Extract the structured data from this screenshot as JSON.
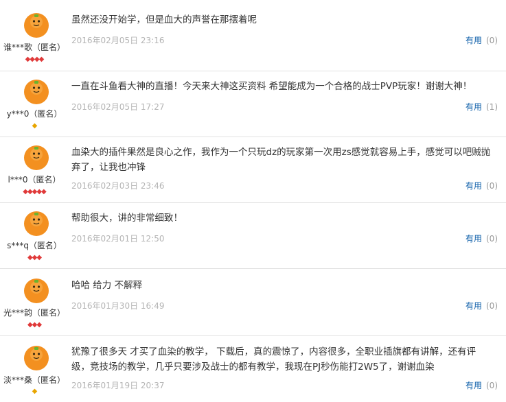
{
  "colors": {
    "avatar_orange": "#f39020",
    "rank_red": "#e03a3a",
    "rank_gold": "#e8a500",
    "link_blue": "#0a5ca8",
    "time_gray": "#b4b4b4",
    "divider": "#e2e2e2"
  },
  "icons": {
    "avatar": "orange-mascot-icon",
    "rank_red": "red-diamond-icon",
    "rank_gold": "gold-diamond-icon"
  },
  "reviews": [
    {
      "user": "谁***歌（匿名）",
      "rank_icons": "◆◆◆◆",
      "rank_color": "red",
      "content": "虽然还没开始学，但是血大的声誉在那摆着呢",
      "time": "2016年02月05日 23:16",
      "useful_label": "有用",
      "useful_count": "(0)"
    },
    {
      "user": "y***0（匿名）",
      "rank_icons": "◆",
      "rank_color": "gold",
      "content": "一直在斗鱼看大神的直播！今天来大神这买资料 希望能成为一个合格的战士PVP玩家！谢谢大神！",
      "time": "2016年02月05日 17:27",
      "useful_label": "有用",
      "useful_count": "(1)"
    },
    {
      "user": "l***0（匿名）",
      "rank_icons": "◆◆◆◆◆",
      "rank_color": "red",
      "content": "血染大的插件果然是良心之作，我作为一个只玩dz的玩家第一次用zs感觉就容易上手，感觉可以吧贼抛弃了，让我也冲锋",
      "time": "2016年02月03日 23:46",
      "useful_label": "有用",
      "useful_count": "(0)"
    },
    {
      "user": "s***q（匿名）",
      "rank_icons": "◆◆◆",
      "rank_color": "red",
      "content": "帮助很大，讲的非常细致！",
      "time": "2016年02月01日 12:50",
      "useful_label": "有用",
      "useful_count": "(0)"
    },
    {
      "user": "光***韵（匿名）",
      "rank_icons": "◆◆◆",
      "rank_color": "red",
      "content": "哈哈 给力 不解释",
      "time": "2016年01月30日 16:49",
      "useful_label": "有用",
      "useful_count": "(0)"
    },
    {
      "user": "淡***桑（匿名）",
      "rank_icons": "◆",
      "rank_color": "gold",
      "content": "犹豫了很多天 才买了血染的教学， 下载后，真的震惊了，内容很多，全职业插旗都有讲解，还有评级，竞技场的教学，几乎只要涉及战士的都有教学，我现在PJ秒伤能打2W5了，谢谢血染",
      "time": "2016年01月19日 20:37",
      "useful_label": "有用",
      "useful_count": "(0)"
    }
  ]
}
